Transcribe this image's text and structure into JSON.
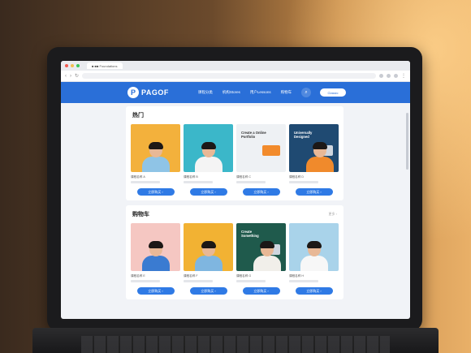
{
  "browser": {
    "tab_title": "■ ■■ Foundations",
    "url": "",
    "window_dots": [
      "#f05a50",
      "#f4bf4f",
      "#3cc65a"
    ]
  },
  "site": {
    "logo_letter": "P",
    "logo_text": "PAGOF",
    "nav": [
      "课程分类",
      "机构Stores",
      "用户Lessons",
      "购物车"
    ],
    "header_button": "Classic",
    "accent": "#2a6fd8"
  },
  "sections": [
    {
      "title": "热门",
      "more": "",
      "cards": [
        {
          "caption": "课程名称 A",
          "button": "立即购买 ›",
          "bg": "#f3b13c",
          "shirt": "#8fc4e6",
          "screen_text": ""
        },
        {
          "caption": "课程名称 B",
          "button": "立即购买 ›",
          "bg": "#3bb7c9",
          "shirt": "#f4f4f4",
          "screen_text": ""
        },
        {
          "caption": "课程名称 C",
          "button": "立即购买 ›",
          "bg": "#eef1f4",
          "shirt": "",
          "screen_text": "Create a Online\nPortfolio"
        },
        {
          "caption": "课程名称 D",
          "button": "立即购买 ›",
          "bg": "#1f4a72",
          "shirt": "#f08a2c",
          "screen_text": "Universally\nDesigned"
        }
      ]
    },
    {
      "title": "购物车",
      "more": "更多 ›",
      "cards": [
        {
          "caption": "课程名称 E",
          "button": "立即购买 ›",
          "bg": "#f5c7c2",
          "shirt": "#3a7bd1",
          "screen_text": ""
        },
        {
          "caption": "课程名称 F",
          "button": "立即购买 ›",
          "bg": "#f2b233",
          "shirt": "#7fb6e0",
          "screen_text": ""
        },
        {
          "caption": "课程名称 G",
          "button": "立即购买 ›",
          "bg": "#1f5a4c",
          "shirt": "#f1efea",
          "screen_text": "Create\nSomething"
        },
        {
          "caption": "课程名称 H",
          "button": "立即购买 ›",
          "bg": "#a9d3ea",
          "shirt": "#f7f7f7",
          "screen_text": ""
        }
      ]
    }
  ]
}
